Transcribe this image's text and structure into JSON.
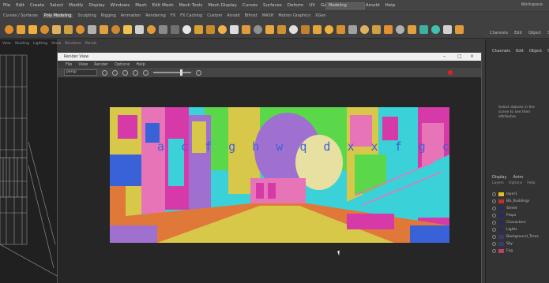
{
  "menubar": {
    "items": [
      "File",
      "Edit",
      "Create",
      "Select",
      "Modify",
      "Display",
      "Windows",
      "Mesh",
      "Edit Mesh",
      "Mesh Tools",
      "Mesh Display",
      "Curves",
      "Surfaces",
      "Deform",
      "UV",
      "Generate",
      "Cache",
      "Arnold",
      "Help"
    ],
    "mode": "Modeling",
    "workspace": "Workspace"
  },
  "shelf": {
    "tabs": [
      "Curves / Surfaces",
      "Poly Modeling",
      "Sculpting",
      "Rigging",
      "Animation",
      "Rendering",
      "FX",
      "FX Caching",
      "Custom",
      "Arnold",
      "Bifrost",
      "MASH",
      "Motion Graphics",
      "XGen"
    ],
    "active_tab": "Poly Modeling",
    "icon_colors": [
      "#e08a2a",
      "#e6a23c",
      "#f0b040",
      "#d8902e",
      "#e0b060",
      "#cfa040",
      "#e09030",
      "#b0b0b0",
      "#e0a040",
      "#cc8830",
      "#f0c050",
      "#d0d0d0",
      "#e09a3a",
      "#8a8a8a",
      "#707070",
      "#e6e6e6",
      "#d8a030",
      "#c98a2a",
      "#f2b04a",
      "#dcdcdc",
      "#e09a3a",
      "#909090",
      "#e8a640",
      "#d09030",
      "#e0e0e0",
      "#c08030",
      "#e6a23c",
      "#f0b040",
      "#d8902e",
      "#a0a0a0",
      "#e0b060",
      "#cfa040",
      "#e09030",
      "#b0b0b0",
      "#e0a040",
      "#3fb0a0",
      "#40c0b0",
      "#d0d0d0",
      "#e09a3a"
    ]
  },
  "right_panel": {
    "tabs": [
      "Channels",
      "Edit",
      "Object",
      "Show"
    ],
    "hint": "Select objects in the scene to see their attributes.",
    "layer_tabs": [
      "Display",
      "Anim"
    ],
    "layer_sub": [
      "Layers",
      "Options",
      "Help"
    ],
    "layers": [
      {
        "name": "layer1",
        "color": "#e0c020"
      },
      {
        "name": "BG_Buildings",
        "color": "#c03030"
      },
      {
        "name": "Street",
        "color": "#2a2a60"
      },
      {
        "name": "Props",
        "color": "#2a2a60"
      },
      {
        "name": "Characters",
        "color": "#2a2a60"
      },
      {
        "name": "Lights",
        "color": "#2a2a60"
      },
      {
        "name": "Background_Trees",
        "color": "#3a3a70"
      },
      {
        "name": "Sky",
        "color": "#3a3a70"
      },
      {
        "name": "Fog",
        "color": "#c04060"
      }
    ]
  },
  "viewport_menu": [
    "View",
    "Shading",
    "Lighting",
    "Show",
    "Renderer",
    "Panels"
  ],
  "render_window": {
    "title": "Render View",
    "menu": [
      "File",
      "View",
      "Render",
      "Options",
      "Help"
    ],
    "camera": "persp",
    "overlay_text": "a c f g h w q d x x f g c",
    "colors": {
      "yellow": "#d8c84a",
      "magenta": "#d63aa8",
      "cyan": "#3ad2d8",
      "green": "#5ad84a",
      "purple": "#a070d0",
      "orange": "#e0783a",
      "blue": "#3a62d8",
      "pink": "#e874b8"
    }
  }
}
